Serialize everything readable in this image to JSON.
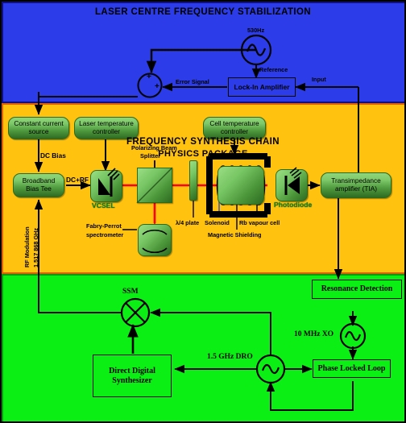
{
  "figure": {
    "type": "block-diagram",
    "subject": "Vapour-cell atomic clock / CPT laser system block diagram"
  },
  "sections": {
    "laser": {
      "title": "LASER CENTRE FREQUENCY STABILIZATION",
      "color": "#2b3ce8",
      "oscillator_label": "530Hz",
      "reference_label": "Reference",
      "error_signal_label": "Error Signal",
      "input_label": "Input",
      "lockin_label": "Lock-In Amplifier",
      "sum_plus_top": "+",
      "sum_plus_right": "+"
    },
    "physics": {
      "title": "PHYSICS PACKAGE",
      "color": "#ffc20e",
      "blocks": {
        "constant_current": "Constant current source",
        "laser_temp": "Laser temperature controller",
        "cell_temp": "Cell temperature controller",
        "bias_tee": "Broadband Bias Tee",
        "tia": "Transimpedance amplifier (TIA)"
      },
      "labels": {
        "dc_bias": "DC Bias",
        "dc_rf": "DC+RF",
        "rf_mod_line1": "RF Modulation",
        "rf_mod_line2": "1.517 868 GHz",
        "vcsel": "VCSEL",
        "pbs_line1": "Polarizing Beam",
        "pbs_line2": "Splitter",
        "fabry_line1": "Fabry-Perrot",
        "fabry_line2": "spectrometer",
        "quarter_wave": "λ/4 plate",
        "solenoid": "Solenoid",
        "rb_cell": "Rb vapour cell",
        "mag_shield": "Magnetic Shielding",
        "photodiode": "Photodiode"
      },
      "beam_color": "#ff0000"
    },
    "frequency": {
      "title": "FREQUENCY SYNTHESIS CHAIN",
      "color": "#0bef14",
      "blocks": {
        "resonance": "Resonance Detection",
        "pll": "Phase Locked Loop",
        "dds_line1": "Direct Digital",
        "dds_line2": "Synthesizer"
      },
      "labels": {
        "ssm": "SSM",
        "xo": "10 MHz XO",
        "dro": "1.5 GHz DRO"
      }
    }
  }
}
